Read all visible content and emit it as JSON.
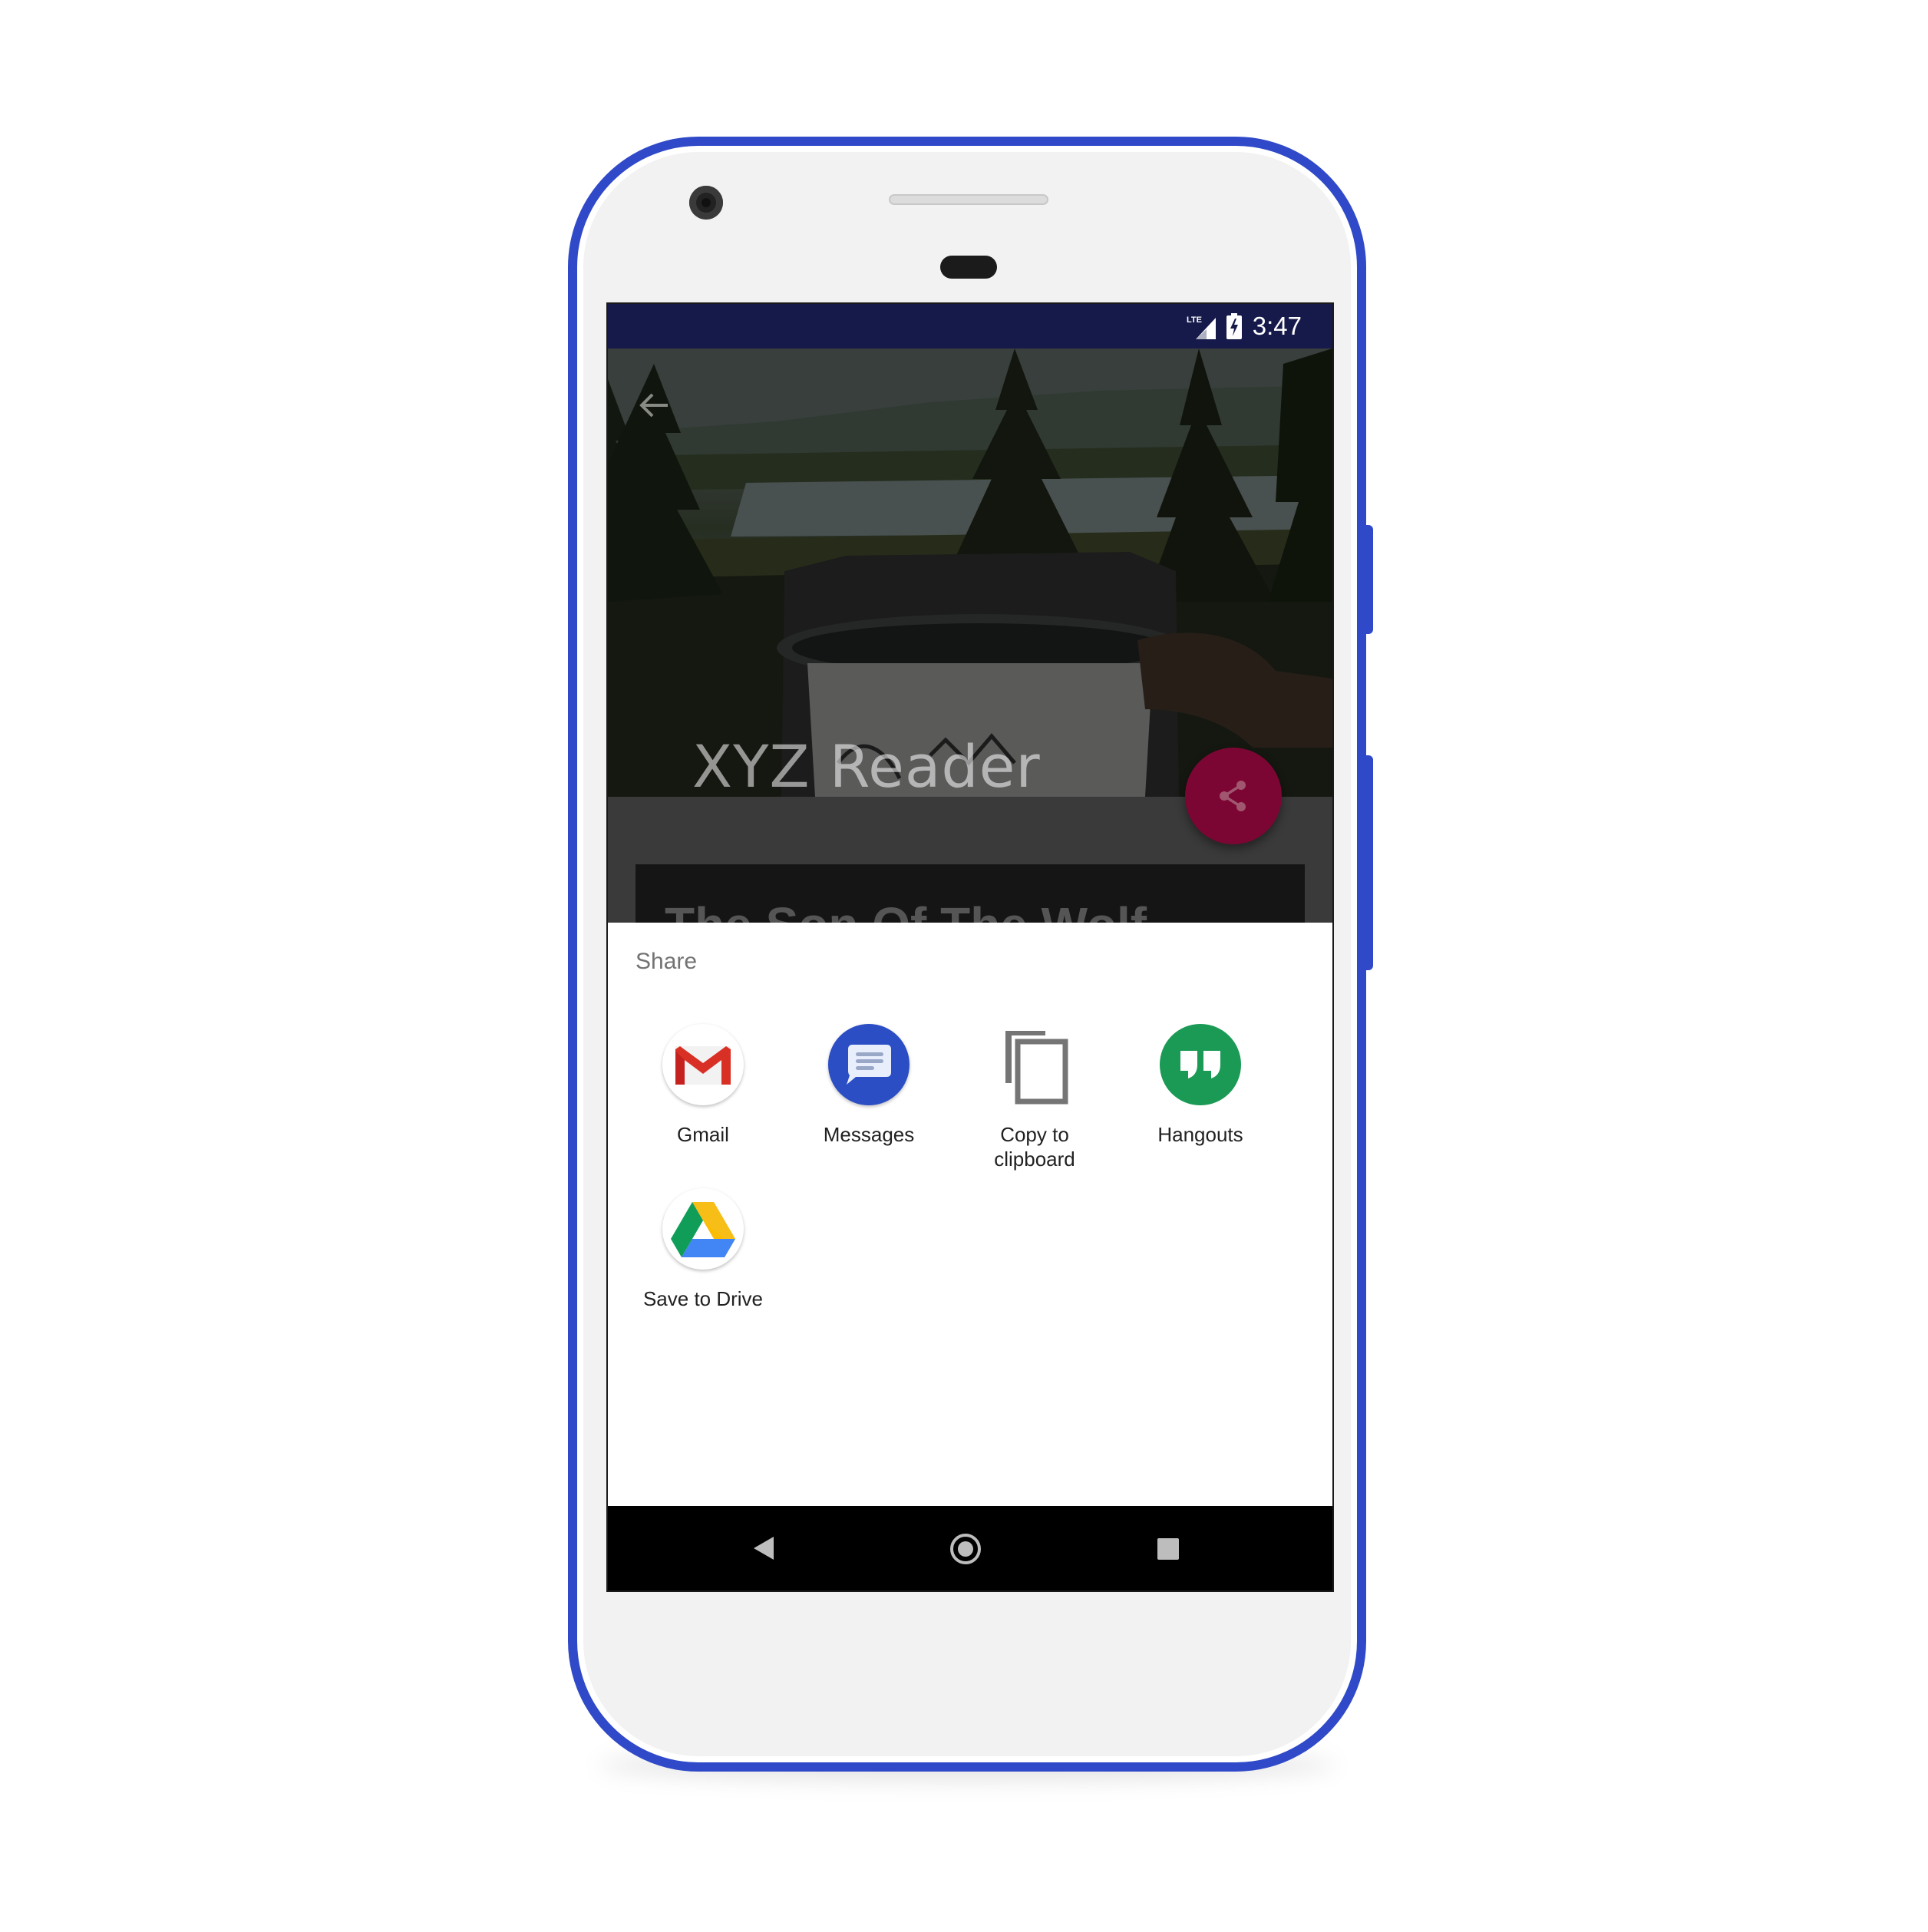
{
  "status_bar": {
    "time": "3:47",
    "network_label": "LTE",
    "icons": [
      "lte-signal-icon",
      "battery-charging-icon"
    ]
  },
  "app": {
    "title": "XYZ Reader",
    "article_title": "The Son Of The Wolf",
    "back_icon": "arrow-back-icon",
    "fab_icon": "share-icon",
    "colors": {
      "status_bar": "#161a4a",
      "fab": "#7c0633",
      "phone_frame": "#2f49c8"
    }
  },
  "share_sheet": {
    "title": "Share",
    "targets": [
      {
        "label": "Gmail",
        "icon": "gmail-icon"
      },
      {
        "label": "Messages",
        "icon": "messages-icon"
      },
      {
        "label_line1": "Copy to",
        "label_line2": "clipboard",
        "icon": "copy-icon"
      },
      {
        "label": "Hangouts",
        "icon": "hangouts-icon"
      },
      {
        "label": "Save to Drive",
        "icon": "drive-icon"
      }
    ]
  },
  "nav_bar": {
    "icons": [
      "nav-back-icon",
      "nav-home-icon",
      "nav-recents-icon"
    ]
  }
}
